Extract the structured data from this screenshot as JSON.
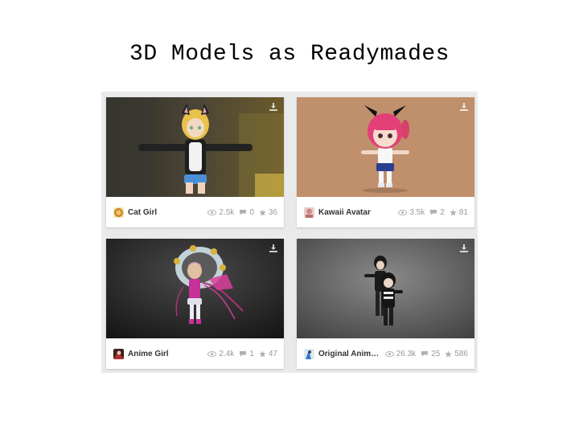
{
  "slide": {
    "title": "3D Models as Readymades"
  },
  "colors": {
    "panel_bg": "#e9eaeb",
    "stat_text": "#9a9a9a",
    "name_text": "#333333"
  },
  "icons": {
    "download": "download-icon",
    "views": "eye-icon",
    "comments": "comment-icon",
    "likes": "star-icon"
  },
  "models": [
    {
      "name": "Cat Girl",
      "views": "2.5k",
      "comments": "0",
      "likes": "36"
    },
    {
      "name": "Kawaii Avatar",
      "views": "3.5k",
      "comments": "2",
      "likes": "81"
    },
    {
      "name": "Anime Girl",
      "views": "2.4k",
      "comments": "1",
      "likes": "47"
    },
    {
      "name": "Original Anime…",
      "views": "26.3k",
      "comments": "25",
      "likes": "586"
    }
  ]
}
